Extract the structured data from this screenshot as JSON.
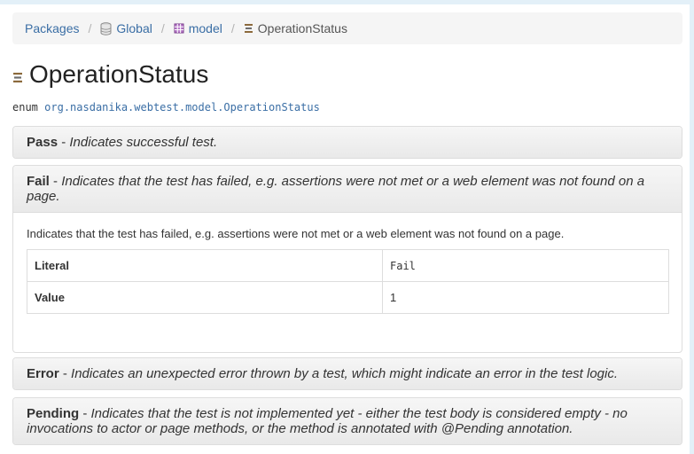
{
  "breadcrumb": {
    "packages": "Packages",
    "global": "Global",
    "model": "model",
    "current": "OperationStatus",
    "separator": "/"
  },
  "header": {
    "title": "OperationStatus",
    "kind": "enum",
    "qualified_name": "org.nasdanika.webtest.model.OperationStatus"
  },
  "literals": [
    {
      "name": "Pass",
      "dash": " - ",
      "summary": "Indicates successful test."
    },
    {
      "name": "Fail",
      "dash": " - ",
      "summary": "Indicates that the test has failed, e.g. assertions were not met or a web element was not found on a page.",
      "description": "Indicates that the test has failed, e.g. assertions were not met or a web element was not found on a page.",
      "table": {
        "literal_label": "Literal",
        "literal_value": "Fail",
        "value_label": "Value",
        "value_value": "1"
      }
    },
    {
      "name": "Error",
      "dash": " - ",
      "summary": "Indicates an unexpected error thrown by a test, which might indicate an error in the test logic."
    },
    {
      "name": "Pending",
      "dash": " - ",
      "summary": "Indicates that the test is not implemented yet - either the test body is considered empty - no invocations to actor or page methods, or the method is annotated with @Pending annotation."
    }
  ],
  "icons": {
    "global": "database-icon",
    "model": "package-icon",
    "enum": "enum-icon"
  },
  "colors": {
    "link": "#3a6ea5",
    "breadcrumb_bg": "#f5f5f5",
    "panel_head_bg": "#eeeeee",
    "border": "#dddddd"
  }
}
